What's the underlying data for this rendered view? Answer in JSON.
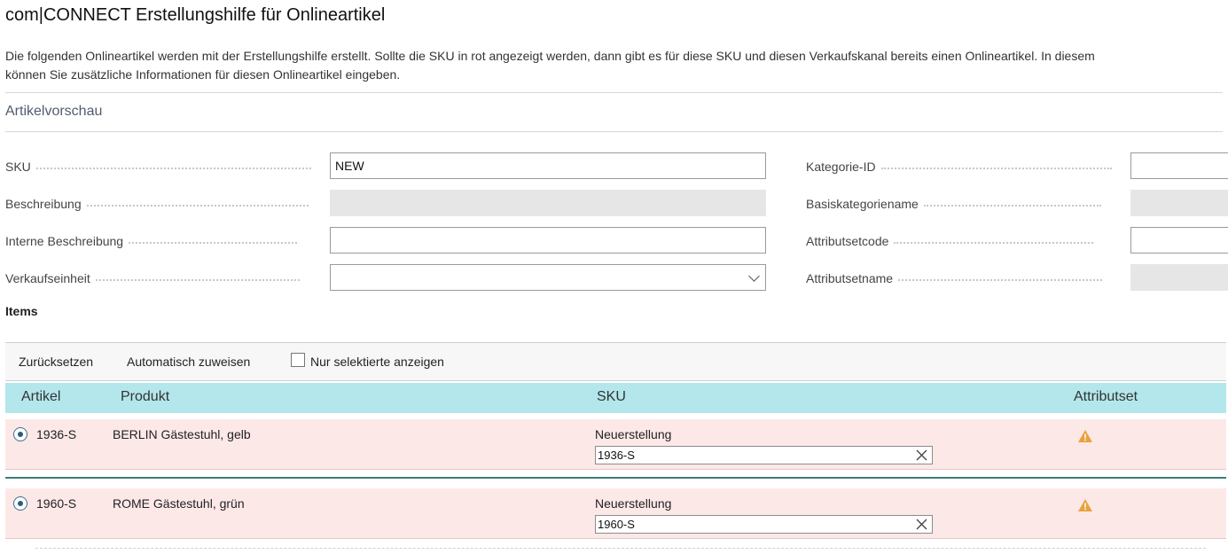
{
  "page": {
    "title": "com|CONNECT Erstellungshilfe für Onlineartikel",
    "intro_line1": "Die folgenden Onlineartikel werden mit der Erstellungshilfe erstellt. Sollte die SKU in rot angezeigt werden, dann gibt es für diese SKU und diesen Verkaufskanal bereits einen Onlineartikel. In diesem",
    "intro_line2": "können Sie zusätzliche Informationen für diesen Onlineartikel eingeben."
  },
  "preview": {
    "section_title": "Artikelvorschau",
    "left_fields": [
      {
        "label": "SKU",
        "value": "NEW",
        "type": "text"
      },
      {
        "label": "Beschreibung",
        "value": "",
        "type": "readonly"
      },
      {
        "label": "Interne Beschreibung",
        "value": "",
        "type": "text"
      },
      {
        "label": "Verkaufseinheit",
        "value": "",
        "type": "dropdown"
      }
    ],
    "right_fields": [
      {
        "label": "Kategorie-ID",
        "value": "",
        "type": "text"
      },
      {
        "label": "Basiskategoriename",
        "value": "",
        "type": "readonly"
      },
      {
        "label": "Attributsetcode",
        "value": "",
        "type": "text"
      },
      {
        "label": "Attributsetname",
        "value": "",
        "type": "readonly"
      }
    ]
  },
  "items": {
    "label": "Items",
    "toolbar": {
      "reset_label": "Zurücksetzen",
      "auto_assign_label": "Automatisch zuweisen",
      "only_selected_label": "Nur selektierte anzeigen"
    },
    "columns": [
      "Artikel",
      "Produkt",
      "SKU",
      "Attributset"
    ],
    "rows": [
      {
        "artikel": "1936-S",
        "produkt": "BERLIN Gästestuhl, gelb",
        "sku_status": "Neuerstellung",
        "sku_value": "1936-S",
        "attributset_icon": "warning-icon"
      },
      {
        "artikel": "1960-S",
        "produkt": "ROME Gästestuhl, grün",
        "sku_status": "Neuerstellung",
        "sku_value": "1960-S",
        "attributset_icon": "warning-icon"
      }
    ]
  },
  "colors": {
    "header_bg": "#b3e7ec",
    "row_error_bg": "#fde8e8",
    "warning": "#e8a33d",
    "selection_line": "#3c7d78"
  }
}
